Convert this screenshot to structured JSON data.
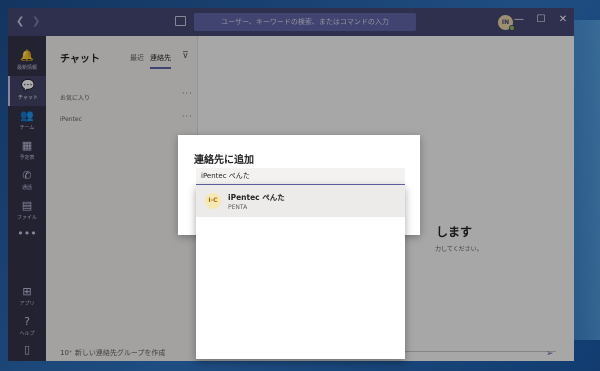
{
  "titlebar": {
    "back_glyph": "❮",
    "forward_glyph": "❯",
    "search_placeholder": "ユーザー、キーワードの検索、またはコマンドの入力",
    "avatar_initials": "IN",
    "minimize": "—",
    "maximize": "☐",
    "close": "✕"
  },
  "rail": {
    "items": [
      {
        "label": "最新情報",
        "icon": "bell-icon",
        "glyph": "🔔"
      },
      {
        "label": "チャット",
        "icon": "chat-icon",
        "glyph": "💬"
      },
      {
        "label": "チーム",
        "icon": "teams-icon",
        "glyph": "👥"
      },
      {
        "label": "予定表",
        "icon": "calendar-icon",
        "glyph": "▦"
      },
      {
        "label": "通話",
        "icon": "phone-icon",
        "glyph": "✆"
      },
      {
        "label": "ファイル",
        "icon": "files-icon",
        "glyph": "▤"
      },
      {
        "label": "",
        "icon": "more-icon",
        "glyph": "•••"
      },
      {
        "label": "アプリ",
        "icon": "apps-icon",
        "glyph": "⊞"
      },
      {
        "label": "ヘルプ",
        "icon": "help-icon",
        "glyph": "?"
      },
      {
        "label": "",
        "icon": "device-icon",
        "glyph": "▯"
      }
    ]
  },
  "chatlist": {
    "title": "チャット",
    "tab_recent": "最近",
    "tab_contacts": "連絡先",
    "filter_glyph": "⊽",
    "groups": [
      {
        "label": "お気に入り",
        "more": "···"
      },
      {
        "label": "iPentec",
        "more": "···"
      }
    ],
    "new_group": "新しい連絡先グループを作成",
    "new_group_glyph": "10⁺"
  },
  "background": {
    "heading": "します",
    "subtext": "力してください。"
  },
  "dialog": {
    "title": "連絡先に追加",
    "input_value": "iPentec ぺんた"
  },
  "results": [
    {
      "name": "iPentec ぺんた",
      "subtitle": "PENTA",
      "avatar_text": "I-C",
      "avatar_color": "#f7e7b0"
    }
  ],
  "colors": {
    "accent": "#6264a7",
    "titlebar": "#464775",
    "rail": "#33344a"
  }
}
